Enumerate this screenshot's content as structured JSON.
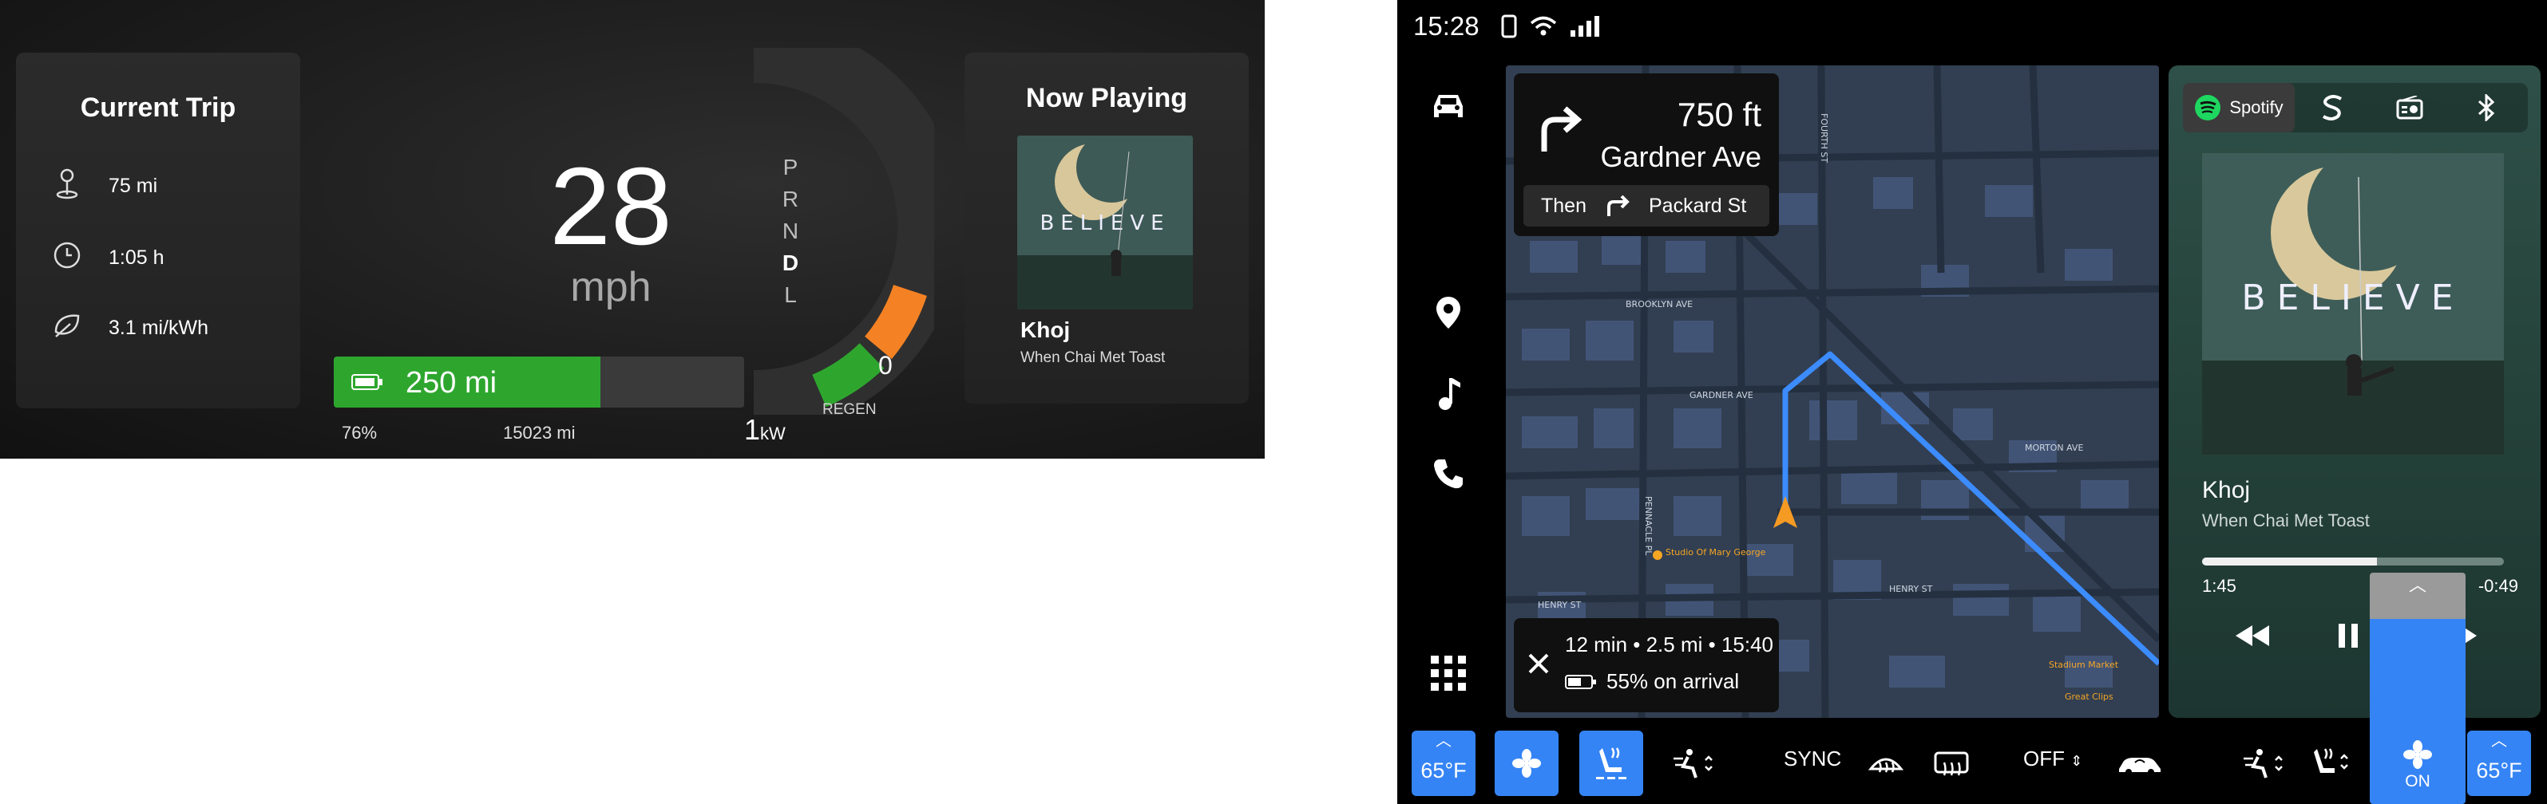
{
  "cluster": {
    "trip": {
      "title": "Current Trip",
      "distance": "75 mi",
      "duration": "1:05 h",
      "efficiency": "3.1 mi/kWh"
    },
    "speed": {
      "value": "28",
      "unit": "mph"
    },
    "gears": [
      "P",
      "R",
      "N",
      "D",
      "L"
    ],
    "selected_gear": "D",
    "power": {
      "zero_label": "0",
      "regen_label": "REGEN",
      "scale_value": "1",
      "scale_unit": "kW"
    },
    "battery": {
      "range": "250 mi",
      "percent": "76%",
      "fill_fraction": 0.65,
      "color": "#2ea62e"
    },
    "odometer": "15023 mi",
    "now_playing": {
      "title": "Now Playing",
      "album_text": "BELIEVE",
      "song": "Khoj",
      "artist": "When Chai Met Toast"
    }
  },
  "center": {
    "status": {
      "time": "15:28"
    },
    "rail": [
      "car-icon",
      "location-pin-icon",
      "music-note-icon",
      "phone-icon",
      "apps-grid-icon"
    ],
    "navigation": {
      "distance": "750 ft",
      "street": "Gardner Ave",
      "then_label": "Then",
      "then_street": "Packard St",
      "eta": "12 min • 2.5 mi • 15:40",
      "arrival": "55% on arrival",
      "map_labels": {
        "brooklyn": "BROOKLYN AVE",
        "gardner": "GARDNER AVE",
        "morton": "MORTON AVE",
        "henry1": "HENRY ST",
        "henry2": "HENRY ST",
        "pennacle": "PENNACLE PL",
        "fourth": "FOURTH ST",
        "poi_studio": "Studio Of Mary George",
        "poi_stadium": "Stadium Market",
        "poi_clips": "Great Clips"
      }
    },
    "media": {
      "source": "Spotify",
      "album_text": "BELIEVE",
      "song": "Khoj",
      "artist": "When Chai Met Toast",
      "elapsed": "1:45",
      "remaining": "-0:49",
      "progress": 0.58
    },
    "climate": {
      "left_temp": "65°F",
      "right_temp": "65°F",
      "sync_label": "SYNC",
      "off_label": "OFF",
      "fan_label": "ON",
      "accent": "#3584f5"
    }
  }
}
